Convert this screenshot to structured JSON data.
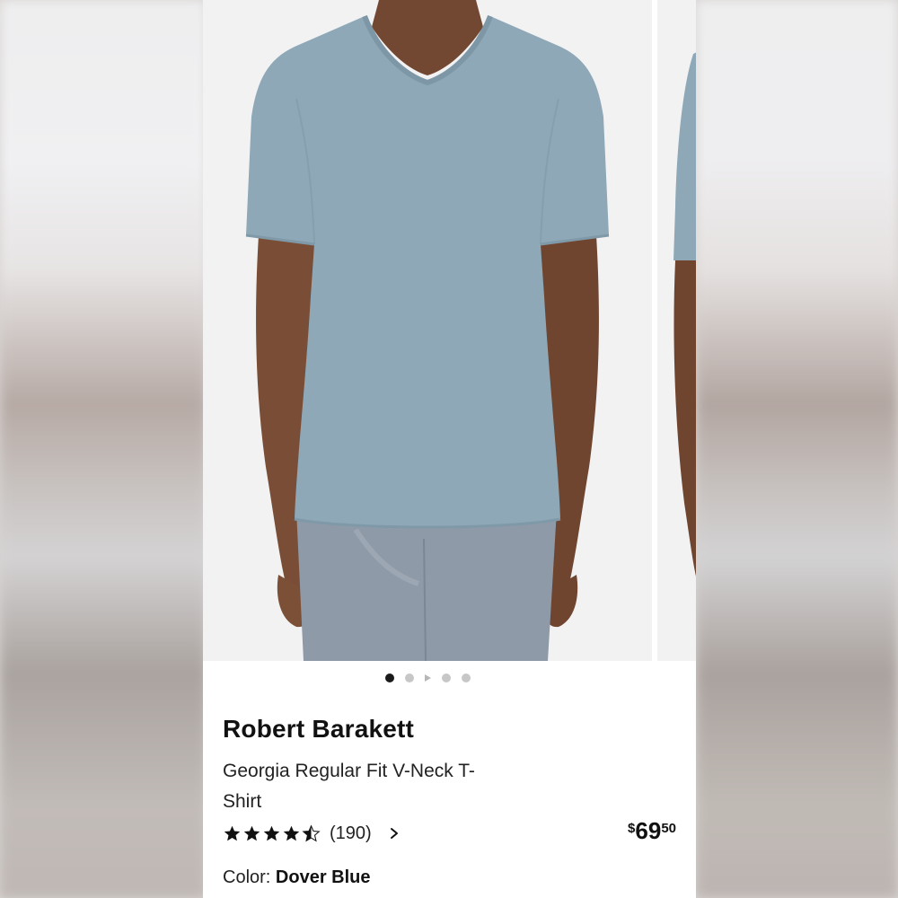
{
  "product": {
    "brand": "Robert Barakett",
    "name": "Georgia Regular Fit V-Neck T-Shirt",
    "rating": {
      "stars": 4.5,
      "max_stars": 5,
      "count": "(190)"
    },
    "price": {
      "currency": "$",
      "dollars": "69",
      "cents": "50"
    },
    "color": {
      "label": "Color:",
      "value": "Dover Blue"
    }
  },
  "carousel": {
    "total_slides": 5,
    "active_slide": 1,
    "video_slide": 3
  },
  "colors": {
    "shirt": "#8ea8b7",
    "jeans": "#8e9aa8",
    "skin": "#7a4e36",
    "background": "#f2f2f3"
  },
  "icons": {
    "rating": "star-icon",
    "reviews_link": "chevron-right-icon",
    "video_dot": "play-icon"
  }
}
